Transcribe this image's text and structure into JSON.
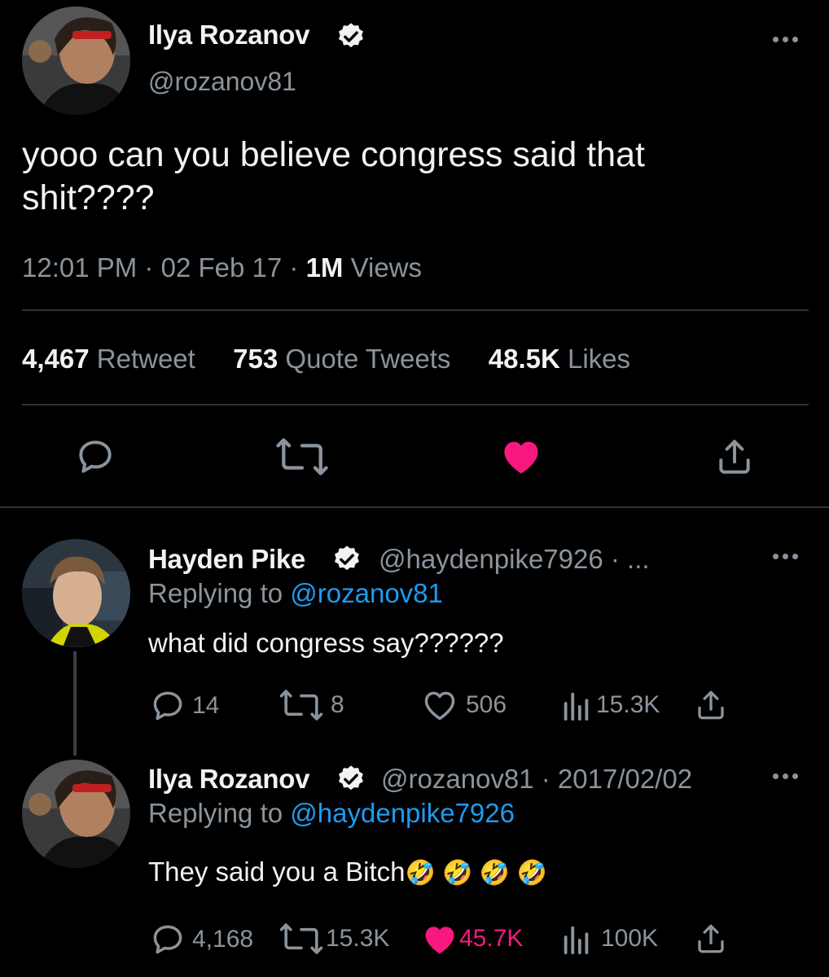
{
  "main_tweet": {
    "author_name": "Ilya Rozanov",
    "handle": "@rozanov81",
    "text_line1": "yooo can you believe congress said that",
    "text_line2": "shit????",
    "time": "12:01 PM",
    "sep1": "·",
    "date": "02 Feb 17",
    "sep2": "·",
    "views_count": "1M",
    "views_label": "Views",
    "retweets_count": "4,467",
    "retweets_label": "Retweet",
    "quotes_count": "753",
    "quotes_label": "Quote Tweets",
    "likes_count": "48.5K",
    "likes_label": "Likes",
    "icons": [
      "reply-icon",
      "retweet-icon",
      "heart-filled-icon",
      "share-icon"
    ]
  },
  "reply1": {
    "author_name": "Hayden Pike",
    "meta": "@haydenpike7926 · ...",
    "replying_prefix": "Replying to",
    "replying_handle": "@rozanov81",
    "text": "what did congress say??????",
    "reply_count": "14",
    "retweet_count": "8",
    "like_count": "506",
    "views_count": "15.3K"
  },
  "reply2": {
    "author_name": "Ilya Rozanov",
    "meta": "@rozanov81 · 2017/02/02",
    "replying_prefix": "Replying to",
    "replying_handle": "@haydenpike7926",
    "text": "They said you a Bitch",
    "emojis": "🤣 🤣 🤣 🤣",
    "reply_count": "4,168",
    "retweet_count": "15.3K",
    "like_count": "45.7K",
    "views_count": "100K"
  },
  "colors": {
    "background": "#000000",
    "accent_blue": "#1d9bf0",
    "like_pink": "#f91880",
    "muted_gray": "#8b949c"
  }
}
